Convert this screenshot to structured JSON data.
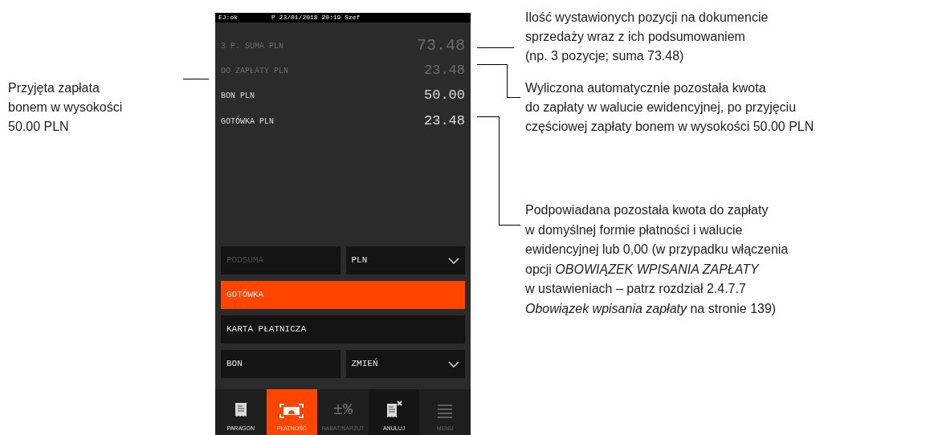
{
  "status_bar": {
    "left": "EJ:ok",
    "center": "P 23/01/2018 20:19 Szef"
  },
  "summary_rows": [
    {
      "label": "3 P. SUMA PLN",
      "value": "73.48",
      "dim": true,
      "large": true
    },
    {
      "label": "DO ZAPŁATY PLN",
      "value": "23.48",
      "dim": true,
      "large": false
    },
    {
      "label": "BON PLN",
      "value": "50.00",
      "dim": false,
      "large": false
    },
    {
      "label": "GOTÓWKA PLN",
      "value": "23.48",
      "dim": false,
      "large": false
    }
  ],
  "payment_buttons": [
    [
      {
        "kind": "button",
        "label": "PODSUMA",
        "disabled": true,
        "selected": false
      },
      {
        "kind": "dropdown",
        "label": "PLN",
        "disabled": false,
        "selected": false
      }
    ],
    [
      {
        "kind": "button",
        "label": "GOTÓWKA",
        "disabled": false,
        "selected": true
      }
    ],
    [
      {
        "kind": "button",
        "label": "KARTA PŁATNICZA",
        "disabled": false,
        "selected": false
      }
    ],
    [
      {
        "kind": "button",
        "label": "BON",
        "disabled": false,
        "selected": false
      },
      {
        "kind": "dropdown",
        "label": "ZMIEŃ",
        "disabled": false,
        "selected": false
      }
    ]
  ],
  "bottom_nav": [
    {
      "kind": "receipt",
      "label": "PARAGON",
      "selected": false,
      "disabled": false
    },
    {
      "kind": "cash",
      "label": "PŁATNOŚĆ",
      "selected": true,
      "disabled": false
    },
    {
      "kind": "text",
      "glyph": "±%",
      "label": "RABAT/NARZUT",
      "selected": false,
      "disabled": true
    },
    {
      "kind": "cancel",
      "label": "ANULUJ",
      "selected": false,
      "disabled": false
    },
    {
      "kind": "menu",
      "label": "MENU",
      "selected": false,
      "disabled": true
    }
  ],
  "left_annotation": {
    "lines": [
      "Przyjęta zapłata",
      "bonem w wysokości",
      "50.00 PLN"
    ]
  },
  "right_annotations": [
    {
      "lines": [
        "Ilość wystawionych pozycji na dokumencie",
        "sprzedaży wraz z ich podsumowaniem",
        "(np. 3 pozycje; suma 73.48)"
      ]
    },
    {
      "lines": [
        "Wyliczona automatycznie pozostała kwota",
        "do zapłaty w walucie ewidencyjnej, po przyjęciu",
        "częściowej zapłaty bonem w wysokości 50.00 PLN"
      ]
    },
    {
      "lines": [
        "Podpowiadana pozostała kwota do zapłaty",
        "w domyślnej formie płatności i walucie",
        "ewidencyjnej lub 0,00 (w przypadku włączenia",
        "opcji *OBOWIĄZEK WPISANIA ZAPŁATY*",
        "w ustawieniach – patrz rozdział 2.4.7.7",
        "*Obowiązek wpisania zapłaty* na stronie 139)"
      ]
    }
  ]
}
